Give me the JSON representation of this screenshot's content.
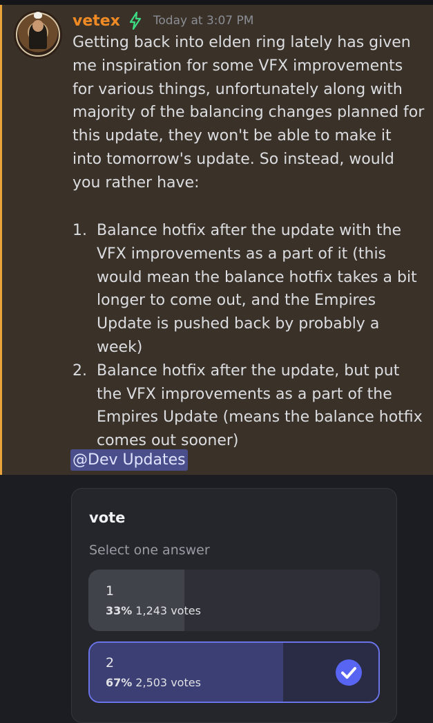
{
  "message": {
    "username": "vetex",
    "timestamp": "Today at 3:07 PM",
    "text": "Getting back into elden ring lately has given me inspiration for some VFX improvements for various things, unfortunately along with majority of the balancing changes planned for this update, they won't be able to make it into tomorrow's update. So instead, would you rather have:",
    "list": [
      {
        "num": "1.",
        "text": "Balance hotfix after the update with the VFX improvements as a part of it (this would mean the balance hotfix takes a bit longer to come out, and the Empires Update is pushed back by probably a week)"
      },
      {
        "num": "2.",
        "text": "Balance hotfix after the update, but put the VFX improvements as a part of the Empires Update (means the balance hotfix comes out sooner)"
      }
    ],
    "mention": "@Dev Updates",
    "icons": {
      "avatar": "user-avatar",
      "badge": "lightning-bolt-icon"
    },
    "colors": {
      "username": "#f08a24",
      "highlight_border": "#e8a33a",
      "mention_bg": "#4a4f8c",
      "badge": "#3ddc84"
    }
  },
  "poll": {
    "question": "vote",
    "subtitle": "Select one answer",
    "answers": [
      {
        "label": "1",
        "percent": "33%",
        "votes": "1,243 votes",
        "fraction": 0.33,
        "selected": false
      },
      {
        "label": "2",
        "percent": "67%",
        "votes": "2,503 votes",
        "fraction": 0.67,
        "selected": true
      }
    ],
    "selected_icon": "checkmark-icon",
    "accent": "#5865f2"
  }
}
